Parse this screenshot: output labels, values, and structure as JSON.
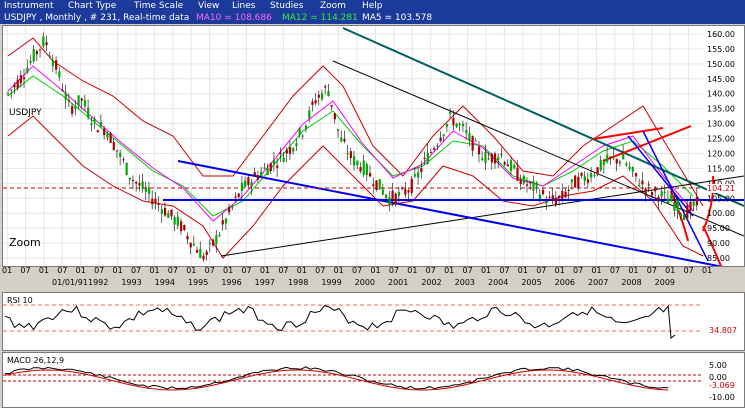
{
  "menu": {
    "instrument": "Instrument",
    "chart_info": "Chart Type",
    "time_scale": "Time Scale",
    "view": "View",
    "lines": "Lines",
    "studies": "Studies",
    "zoom": "Zoom",
    "help": "Help"
  },
  "header": {
    "title": "USDJPY , Monthly , # 231, Real-time data",
    "ma10": "MA10 = 108.686",
    "ma12": "MA12 = 114.281",
    "ma5": "MA5 = 103.578",
    "symbol": "USDJPY"
  },
  "colors": {
    "ma10": "#ff00ff",
    "ma12": "#00cc00",
    "ma5": "#ffffff",
    "menubar": "#1b3a9a",
    "up": "#00aa00",
    "down": "#aa0000"
  },
  "main": {
    "zoom_label": "Zoom",
    "y_ticks": [
      "160.00",
      "155.00",
      "150.00",
      "145.00",
      "140.00",
      "135.00",
      "130.00",
      "125.00",
      "120.00",
      "115.00",
      "110.00",
      "105.00",
      "100.00",
      "95.00",
      "90.00",
      "85.00"
    ],
    "price_tag": "104.21",
    "low_tag": "90.00"
  },
  "x_axis": {
    "months": [
      "01",
      "07",
      "01",
      "07",
      "01",
      "07",
      "01",
      "07",
      "01",
      "07",
      "01",
      "07",
      "01",
      "07",
      "01",
      "07",
      "01",
      "07",
      "01",
      "07",
      "01",
      "07",
      "01",
      "07",
      "01",
      "07",
      "01",
      "07",
      "01",
      "07",
      "01",
      "07",
      "01",
      "07",
      "01",
      "07",
      "01",
      "07",
      "01"
    ],
    "years": [
      "01/01/91",
      "1992",
      "1993",
      "1994",
      "1995",
      "1996",
      "1997",
      "1998",
      "1999",
      "2000",
      "2001",
      "2002",
      "2003",
      "2004",
      "2005",
      "2006",
      "2007",
      "2008",
      "2009"
    ]
  },
  "rsi": {
    "label": "RSI 10",
    "value_tag": "34.807"
  },
  "macd": {
    "label": "MACD 26,12,9",
    "ticks": [
      "5.00",
      "0.00",
      "-5.00",
      "-10.00"
    ],
    "value_tag": "-3.069"
  },
  "chart_data": {
    "type": "candlestick",
    "ylim": [
      85,
      160
    ],
    "series": [
      {
        "name": "USDJPY",
        "values": [
          140,
          145,
          152,
          158,
          148,
          135,
          138,
          130,
          128,
          120,
          112,
          108,
          104,
          100,
          96,
          90,
          85,
          92,
          100,
          108,
          112,
          115,
          118,
          122,
          128,
          138,
          142,
          125,
          118,
          115,
          110,
          105,
          106,
          110,
          118,
          125,
          132,
          128,
          122,
          118,
          120,
          115,
          110,
          108,
          104,
          105,
          110,
          112,
          115,
          118,
          118,
          112,
          108,
          106,
          104,
          100,
          103
        ]
      }
    ]
  }
}
